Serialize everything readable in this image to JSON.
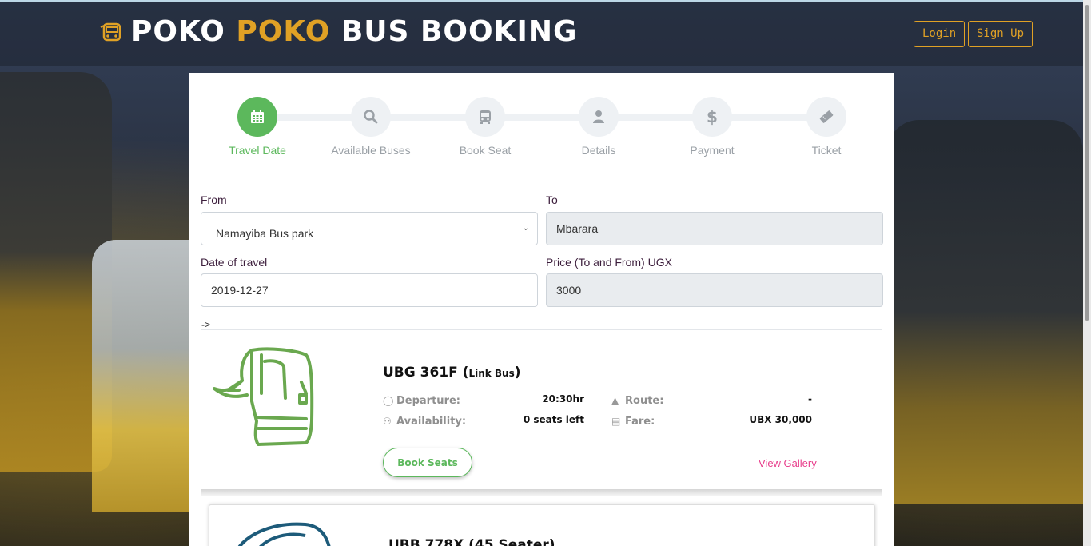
{
  "brand": {
    "word1": "POKO",
    "word2": "POKO",
    "word3": "BUS BOOKING",
    "accent_color": "#e0a125"
  },
  "nav": {
    "login_label": "Login",
    "signup_label": "Sign Up"
  },
  "steps": [
    {
      "label": "Travel Date",
      "icon": "calendar-icon",
      "active": true
    },
    {
      "label": "Available Buses",
      "icon": "search-icon",
      "active": false
    },
    {
      "label": "Book Seat",
      "icon": "bus-icon",
      "active": false
    },
    {
      "label": "Details",
      "icon": "user-icon",
      "active": false
    },
    {
      "label": "Payment",
      "icon": "dollar-icon",
      "active": false
    },
    {
      "label": "Ticket",
      "icon": "ticket-icon",
      "active": false
    }
  ],
  "form": {
    "from_label": "From",
    "from_value": "Namayiba Bus park",
    "to_label": "To",
    "to_value": "Mbarara",
    "date_label": "Date of travel",
    "date_value": "2019-12-27",
    "price_label": "Price (To and From) UGX",
    "price_value": "3000",
    "arrow_text": "->"
  },
  "buses": [
    {
      "plate": "UBG 361F",
      "name": "Link Bus",
      "departure_label": "Departure:",
      "departure_value": "20:30hr",
      "availability_label": "Availability:",
      "availability_value": "0 seats left",
      "route_label": "Route:",
      "route_value": "-",
      "fare_label": "Fare:",
      "fare_value": "UBX 30,000",
      "book_label": "Book Seats",
      "gallery_label": "View Gallery",
      "icon_color": "#6aa84f"
    },
    {
      "title": "UBB 778X (45 Seater)",
      "icon_color": "#1d5b7a"
    }
  ],
  "colors": {
    "success": "#5cb85c",
    "link": "#e83e8c"
  }
}
